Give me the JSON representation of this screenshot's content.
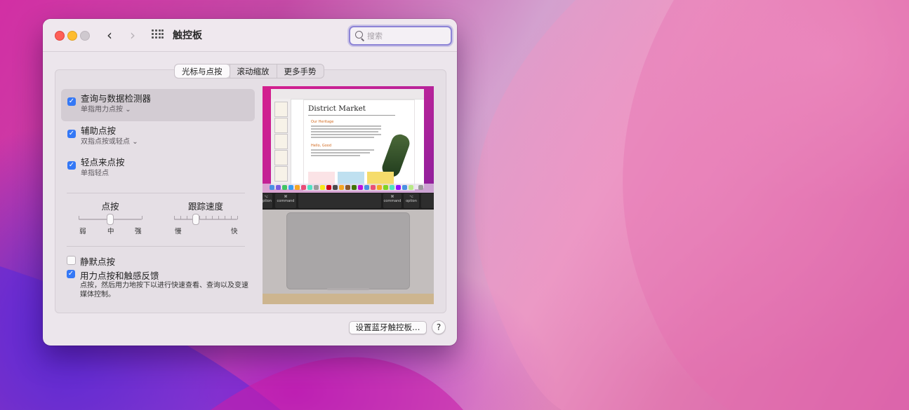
{
  "window": {
    "title": "触控板",
    "search_placeholder": "搜索"
  },
  "tabs": [
    "光标与点按",
    "滚动缩放",
    "更多手势"
  ],
  "active_tab": 0,
  "options": [
    {
      "label": "查询与数据检测器",
      "sub": "单指用力点按",
      "checked": true,
      "has_menu": true
    },
    {
      "label": "辅助点按",
      "sub": "双指点按或轻点",
      "checked": true,
      "has_menu": true
    },
    {
      "label": "轻点来点按",
      "sub": "单指轻点",
      "checked": true,
      "has_menu": false
    }
  ],
  "sliders": {
    "click": {
      "label": "点按",
      "min_label": "弱",
      "mid_label": "中",
      "max_label": "强",
      "value_index": 1,
      "steps": 3
    },
    "tracking": {
      "label": "跟踪速度",
      "min_label": "慢",
      "max_label": "快",
      "value_fraction": 0.33
    }
  },
  "silent_click": {
    "label": "静默点按",
    "checked": false
  },
  "force_click": {
    "label": "用力点按和触感反馈",
    "checked": true,
    "description": "点按，然后用力地按下以进行快速查看、查询以及变速媒体控制。"
  },
  "preview": {
    "doc_title": "District Market",
    "doc_heading": "Our Heritage",
    "doc_heading2": "Hello, Good",
    "keys": [
      "option",
      "command",
      "command",
      "option"
    ]
  },
  "buttons": {
    "bluetooth": "设置蓝牙触控板…",
    "help": "?"
  },
  "colors": {
    "accent": "#3478f6",
    "search_focus": "#8d84d6"
  }
}
